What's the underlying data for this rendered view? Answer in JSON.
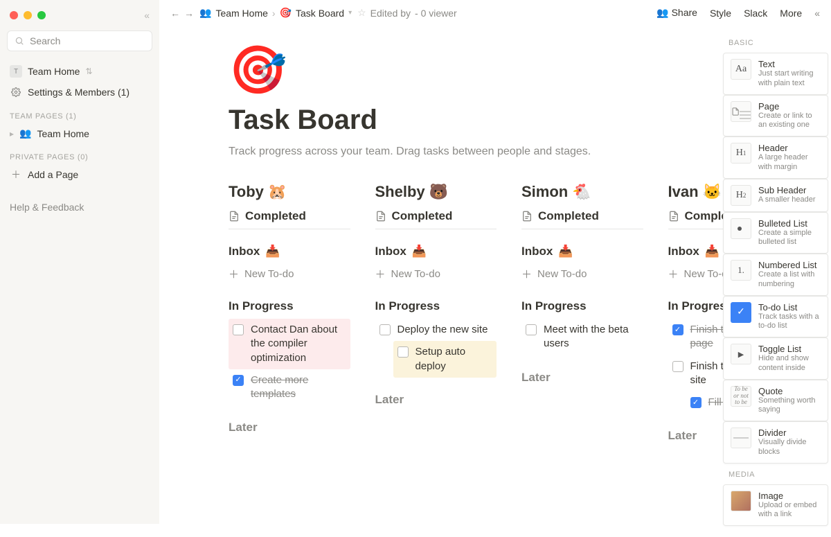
{
  "sidebar": {
    "search_placeholder": "Search",
    "workspace_name": "Team Home",
    "settings_label": "Settings & Members (1)",
    "sections": {
      "team_pages_label": "TEAM PAGES (1)",
      "team_page_item": "Team Home",
      "private_pages_label": "PRIVATE PAGES (0)",
      "add_page_label": "Add a Page"
    },
    "help_label": "Help & Feedback"
  },
  "topbar": {
    "breadcrumbs": [
      {
        "emoji": "👥",
        "label": "Team Home"
      },
      {
        "emoji": "🎯",
        "label": "Task Board"
      }
    ],
    "edited_by_label": "Edited by",
    "viewers_label": "- 0 viewer",
    "actions": [
      "Share",
      "Style",
      "Slack",
      "More"
    ]
  },
  "page": {
    "icon": "🎯",
    "title": "Task Board",
    "subtitle": "Track progress across your team.  Drag tasks between people and stages."
  },
  "stages_labels": {
    "completed": "Completed",
    "inbox": "Inbox",
    "new_todo": "New To-do",
    "in_progress": "In Progress",
    "later": "Later"
  },
  "columns": [
    {
      "name": "Toby",
      "emoji": "🐹",
      "in_progress": [
        {
          "text": "Contact Dan about the compiler optimization",
          "checked": false,
          "highlight": "pink",
          "indent": false
        },
        {
          "text": "Create more templates",
          "checked": true,
          "highlight": "",
          "indent": false
        }
      ]
    },
    {
      "name": "Shelby",
      "emoji": "🐻",
      "in_progress": [
        {
          "text": "Deploy the new site",
          "checked": false,
          "highlight": "",
          "indent": false
        },
        {
          "text": "Setup auto deploy",
          "checked": false,
          "highlight": "yellow",
          "indent": true
        }
      ]
    },
    {
      "name": "Simon",
      "emoji": "🐔",
      "in_progress": [
        {
          "text": "Meet with the beta users",
          "checked": false,
          "highlight": "",
          "indent": false
        }
      ]
    },
    {
      "name": "Ivan",
      "emoji": "🐱",
      "in_progress": [
        {
          "text": "Finish the about page",
          "checked": true,
          "highlight": "",
          "indent": false
        },
        {
          "text": "Finish the marketing site",
          "checked": false,
          "highlight": "",
          "indent": false
        },
        {
          "text": "Fill out copy",
          "checked": true,
          "highlight": "",
          "indent": true
        }
      ]
    }
  ],
  "block_menu": {
    "section_basic": "BASIC",
    "section_media": "MEDIA",
    "items": [
      {
        "thumb": "Aa",
        "title": "Text",
        "desc": "Just start writing with plain text"
      },
      {
        "thumb": "page",
        "title": "Page",
        "desc": "Create or link to an existing one"
      },
      {
        "thumb": "H1",
        "title": "Header",
        "desc": "A large header with margin"
      },
      {
        "thumb": "H2",
        "title": "Sub Header",
        "desc": "A smaller header"
      },
      {
        "thumb": "bullet",
        "title": "Bulleted List",
        "desc": "Create a simple bulleted list"
      },
      {
        "thumb": "numbered",
        "title": "Numbered List",
        "desc": "Create a list with numbering"
      },
      {
        "thumb": "check",
        "title": "To-do List",
        "desc": "Track tasks with a to-do list"
      },
      {
        "thumb": "toggle",
        "title": "Toggle List",
        "desc": "Hide and show content inside"
      },
      {
        "thumb": "quote",
        "title": "Quote",
        "desc": "Something worth saying"
      },
      {
        "thumb": "divider",
        "title": "Divider",
        "desc": "Visually divide blocks"
      }
    ],
    "media_item": {
      "thumb": "image",
      "title": "Image",
      "desc": "Upload or embed with a link"
    }
  }
}
